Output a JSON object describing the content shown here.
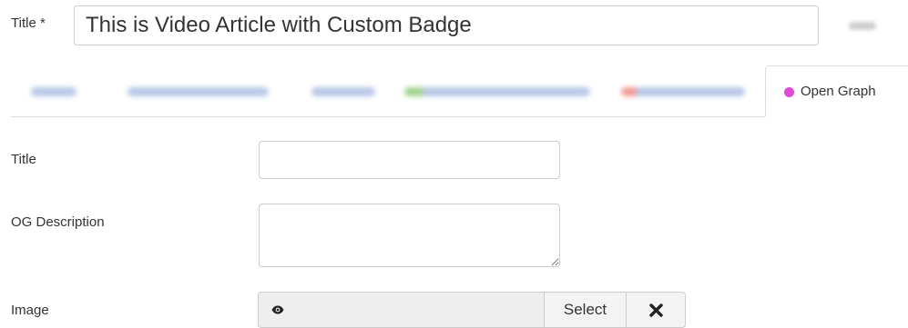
{
  "article": {
    "title_label": "Title *",
    "title_value": "This is Video Article with Custom Badge"
  },
  "tabs": [
    {
      "id": "content",
      "blurred": true,
      "color": "#b7c7e6"
    },
    {
      "id": "images",
      "blurred": true,
      "color": "#b7c7e6"
    },
    {
      "id": "options",
      "blurred": true,
      "color": "#b7c7e6"
    },
    {
      "id": "article-type",
      "blurred": true,
      "color": "#b9dcae"
    },
    {
      "id": "blog",
      "blurred": true,
      "color": "#f3b8b3"
    },
    {
      "id": "open-graph",
      "label": "Open Graph",
      "active": true,
      "dot_color": "#e04ad6"
    }
  ],
  "form": {
    "og_title_label": "Title",
    "og_title_value": "",
    "og_description_label": "OG Description",
    "og_description_value": "",
    "image_label": "Image",
    "image_path_value": "",
    "select_label": "Select"
  },
  "icons": {
    "preview": "eye-icon",
    "clear": "close-icon"
  }
}
